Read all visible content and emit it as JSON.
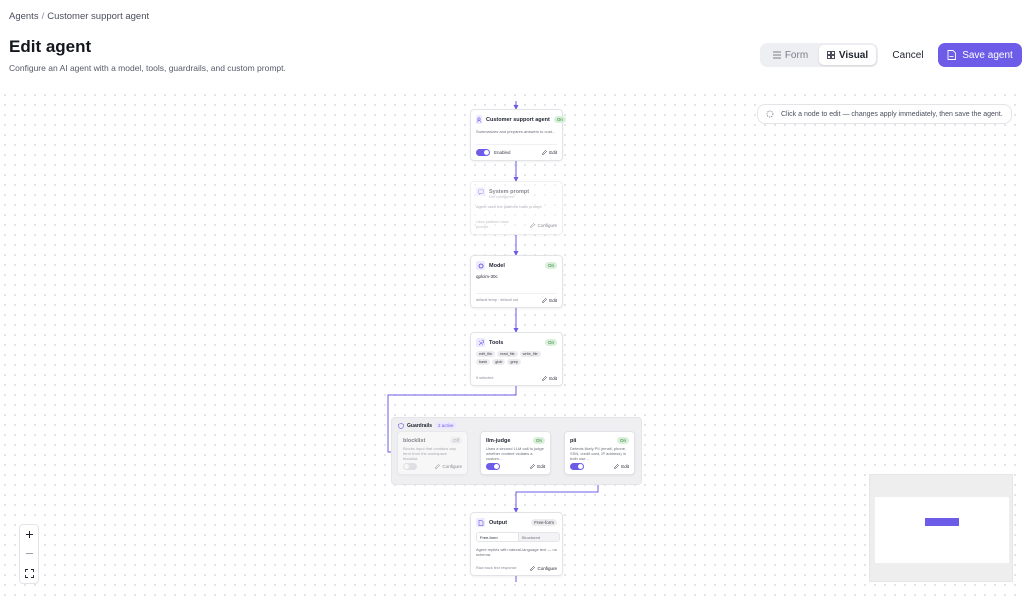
{
  "breadcrumb": {
    "root": "Agents",
    "separator": "/",
    "current": "Customer support agent"
  },
  "header": {
    "title": "Edit agent",
    "subtitle": "Configure an AI agent with a model, tools, guardrails, and custom prompt."
  },
  "view_toggle": {
    "form_label": "Form",
    "visual_label": "Visual",
    "selected": "Visual"
  },
  "actions": {
    "cancel_label": "Cancel",
    "save_label": "Save agent"
  },
  "hint": {
    "text": "Click a node to edit — changes apply immediately, then save the agent."
  },
  "nodes": {
    "agent": {
      "title": "Customer support agent",
      "badge": "On",
      "description": "Summarizes and prepares answers to cust...",
      "toggle_label": "Enabled",
      "edit_label": "Edit"
    },
    "prompt": {
      "title": "System prompt",
      "subtitle": "Not configured",
      "description": "Agent uses the platform base prompt",
      "footer": "Uses platform base prompt",
      "action_label": "Configure"
    },
    "model": {
      "title": "Model",
      "badge": "On",
      "value": "qplcim-30c",
      "footer": "default temp · default out",
      "edit_label": "Edit"
    },
    "tools": {
      "title": "Tools",
      "badge": "On",
      "chips": [
        "edit_file",
        "read_file",
        "write_file",
        "bash",
        "glob",
        "grep"
      ],
      "footer": "6 selected",
      "edit_label": "Edit"
    },
    "guardrails": {
      "title": "Guardrails",
      "badge": "2 active",
      "items": [
        {
          "name": "blocklist",
          "badge": "Off",
          "description": "Blocks input that contains any term from the workspace blocklist.",
          "action_label": "Configure",
          "enabled": false
        },
        {
          "name": "llm-judge",
          "badge": "On",
          "description": "Uses a second LLM call to judge whether content violates a custom...",
          "action_label": "Edit",
          "enabled": true
        },
        {
          "name": "pii",
          "badge": "On",
          "description": "Detects likely PII (email, phone, SSN, credit card, IP address) in both use...",
          "action_label": "Edit",
          "enabled": true
        }
      ]
    },
    "output": {
      "title": "Output",
      "badge": "Free-form",
      "segments": [
        "Free-form",
        "Structured"
      ],
      "description": "Agent replies with natural-language text — no schema.",
      "footer": "Raw back text response",
      "action_label": "Configure"
    }
  },
  "colors": {
    "accent": "#6c5ce7",
    "on_badge": "#d8f0d9",
    "canvas_dot": "#d9dbe0"
  },
  "icons": [
    "list-icon",
    "grid-icon",
    "save-icon",
    "sparkle-icon",
    "user-icon",
    "message-icon",
    "cpu-icon",
    "wrench-icon",
    "shield-icon",
    "file-icon",
    "pencil-icon",
    "plus-icon",
    "minus-icon",
    "fit-view-icon"
  ]
}
